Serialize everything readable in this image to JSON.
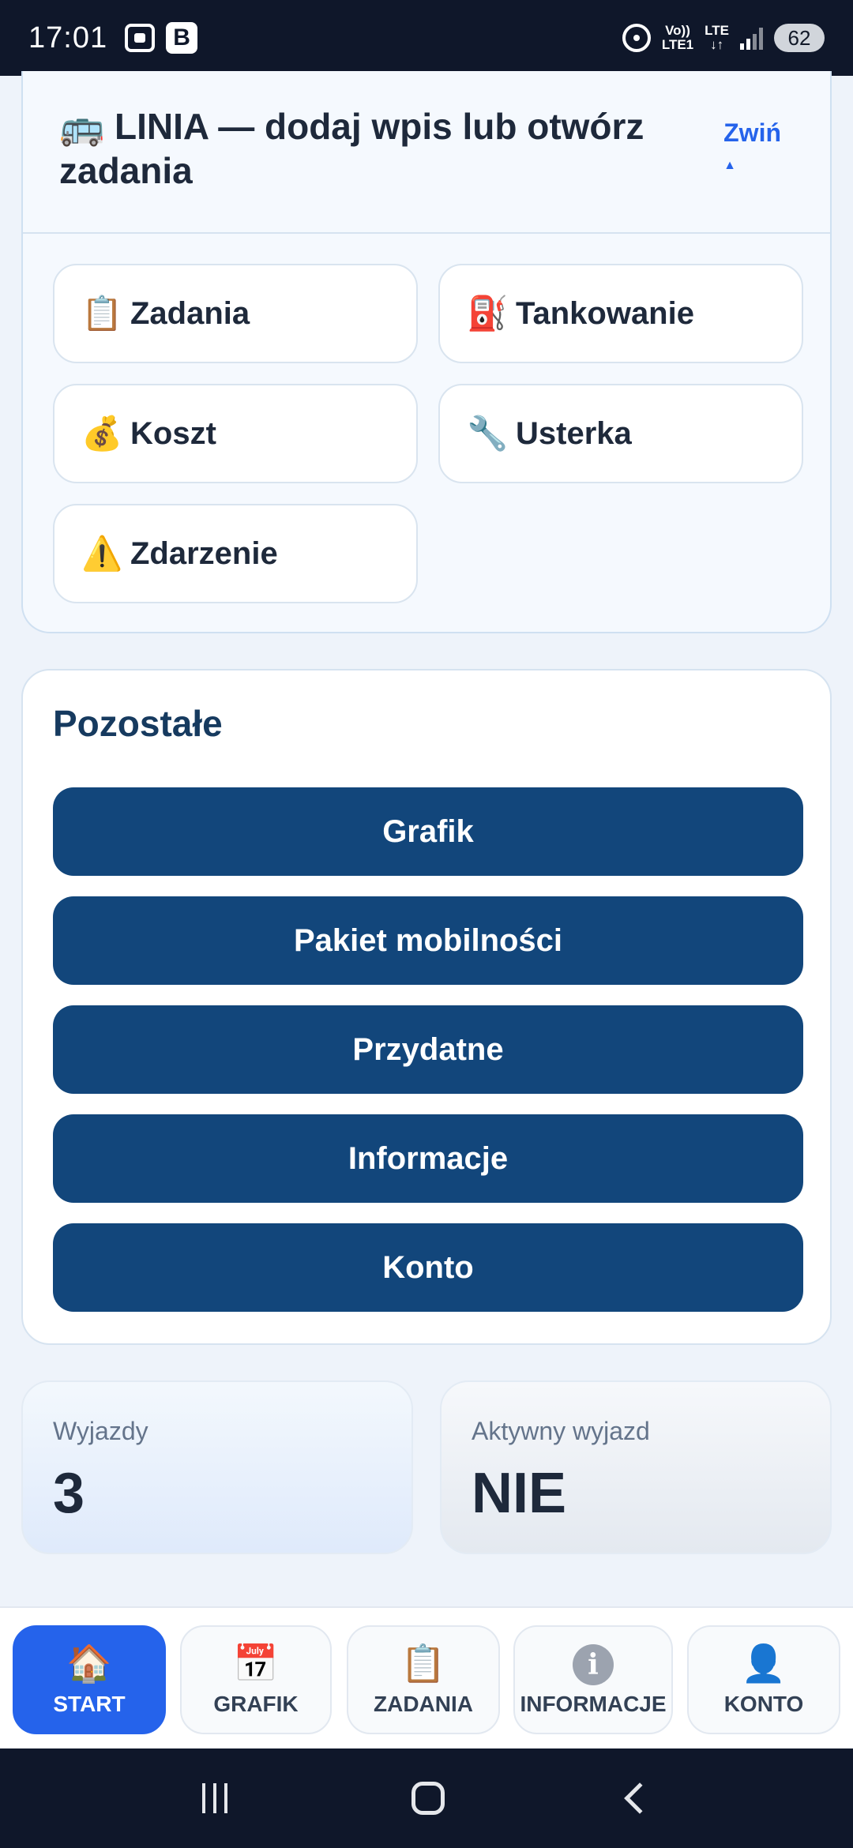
{
  "status_bar": {
    "time": "17:01",
    "volte_top": "Vo))",
    "volte_bottom": "LTE1",
    "lte_label": "LTE",
    "battery": "62"
  },
  "linia": {
    "title": "🚌 LINIA — dodaj wpis lub otwórz zadania",
    "collapse_label": "Zwiń",
    "collapse_arrow": "▲",
    "actions": [
      {
        "icon": "📋",
        "label": "Zadania"
      },
      {
        "icon": "⛽",
        "label": "Tankowanie"
      },
      {
        "icon": "💰",
        "label": "Koszt"
      },
      {
        "icon": "🔧",
        "label": "Usterka"
      },
      {
        "icon": "⚠️",
        "label": "Zdarzenie"
      }
    ]
  },
  "other": {
    "title": "Pozostałe",
    "buttons": [
      "Grafik",
      "Pakiet mobilności",
      "Przydatne",
      "Informacje",
      "Konto"
    ]
  },
  "stats": {
    "trips": {
      "label": "Wyjazdy",
      "value": "3"
    },
    "active": {
      "label": "Aktywny wyjazd",
      "value": "NIE"
    }
  },
  "tabs": [
    {
      "icon": "🏠",
      "label": "START",
      "active": true
    },
    {
      "icon": "📅",
      "label": "GRAFIK"
    },
    {
      "icon": "📋",
      "label": "ZADANIA"
    },
    {
      "icon": "i",
      "label": "INFORMACJE"
    },
    {
      "icon": "👤",
      "label": "KONTO"
    }
  ],
  "colors": {
    "primary_button": "#12467b",
    "active_tab": "#2563eb",
    "link": "#2563eb"
  }
}
